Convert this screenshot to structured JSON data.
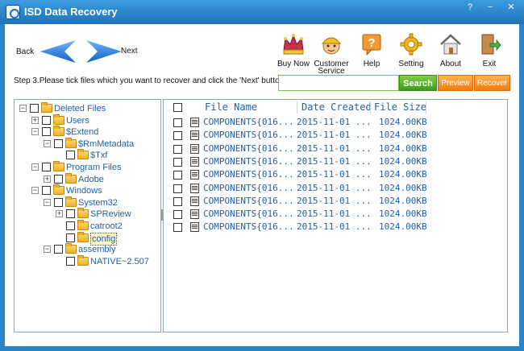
{
  "window": {
    "title": "ISD Data Recovery",
    "help_glyph": "?",
    "minimize_glyph": "−",
    "close_glyph": "✕"
  },
  "nav": {
    "back_label": "Back",
    "next_label": "Next"
  },
  "toolbar": [
    {
      "key": "buy",
      "label": "Buy Now",
      "icon": "crown-icon"
    },
    {
      "key": "support",
      "label": "Customer\nService",
      "icon": "support-person-icon"
    },
    {
      "key": "help",
      "label": "Help",
      "icon": "help-icon"
    },
    {
      "key": "setting",
      "label": "Setting",
      "icon": "gear-icon"
    },
    {
      "key": "about",
      "label": "About",
      "icon": "house-icon"
    },
    {
      "key": "exit",
      "label": "Exit",
      "icon": "exit-door-icon"
    }
  ],
  "step_text": "Step 3.Please tick files which you want to recover and click the 'Next' button.",
  "search": {
    "value": "",
    "button_label": "Search"
  },
  "actions": {
    "preview_label": "Preview",
    "recover_label": "Recover"
  },
  "tree": [
    {
      "label": "Deleted Files",
      "level": 0,
      "expander": "−"
    },
    {
      "label": "Users",
      "level": 1,
      "expander": "+"
    },
    {
      "label": "$Extend",
      "level": 1,
      "expander": "−"
    },
    {
      "label": "$RmMetadata",
      "level": 2,
      "expander": "−"
    },
    {
      "label": "$Txf",
      "level": 3,
      "expander": ""
    },
    {
      "label": "Program Files",
      "level": 1,
      "expander": "−"
    },
    {
      "label": "Adobe",
      "level": 2,
      "expander": "+"
    },
    {
      "label": "Windows",
      "level": 1,
      "expander": "−"
    },
    {
      "label": "System32",
      "level": 2,
      "expander": "−"
    },
    {
      "label": "SPReview",
      "level": 3,
      "expander": "+"
    },
    {
      "label": "catroot2",
      "level": 3,
      "expander": ""
    },
    {
      "label": "config",
      "level": 3,
      "expander": "",
      "selected": true
    },
    {
      "label": "assembly",
      "level": 2,
      "expander": "−"
    },
    {
      "label": "NATIVE~2.507",
      "level": 3,
      "expander": ""
    }
  ],
  "list": {
    "columns": [
      "File Name",
      "Date Created",
      "File Size"
    ],
    "rows": [
      {
        "name": "COMPONENTS{016...",
        "date": "2015-11-01 ...",
        "size": "1024.00KB"
      },
      {
        "name": "COMPONENTS{016...",
        "date": "2015-11-01 ...",
        "size": "1024.00KB"
      },
      {
        "name": "COMPONENTS{016...",
        "date": "2015-11-01 ...",
        "size": "1024.00KB"
      },
      {
        "name": "COMPONENTS{016...",
        "date": "2015-11-01 ...",
        "size": "1024.00KB"
      },
      {
        "name": "COMPONENTS{016...",
        "date": "2015-11-01 ...",
        "size": "1024.00KB"
      },
      {
        "name": "COMPONENTS{016...",
        "date": "2015-11-01 ...",
        "size": "1024.00KB"
      },
      {
        "name": "COMPONENTS{016...",
        "date": "2015-11-01 ...",
        "size": "1024.00KB"
      },
      {
        "name": "COMPONENTS{016...",
        "date": "2015-11-01 ...",
        "size": "1024.00KB"
      },
      {
        "name": "COMPONENTS{016...",
        "date": "2015-11-01 ...",
        "size": "1024.00KB"
      }
    ]
  },
  "colors": {
    "titlebar": "#2a84c9",
    "link_text": "#1f5fa6",
    "search_green": "#4aa81f",
    "action_orange": "#f08a17"
  }
}
